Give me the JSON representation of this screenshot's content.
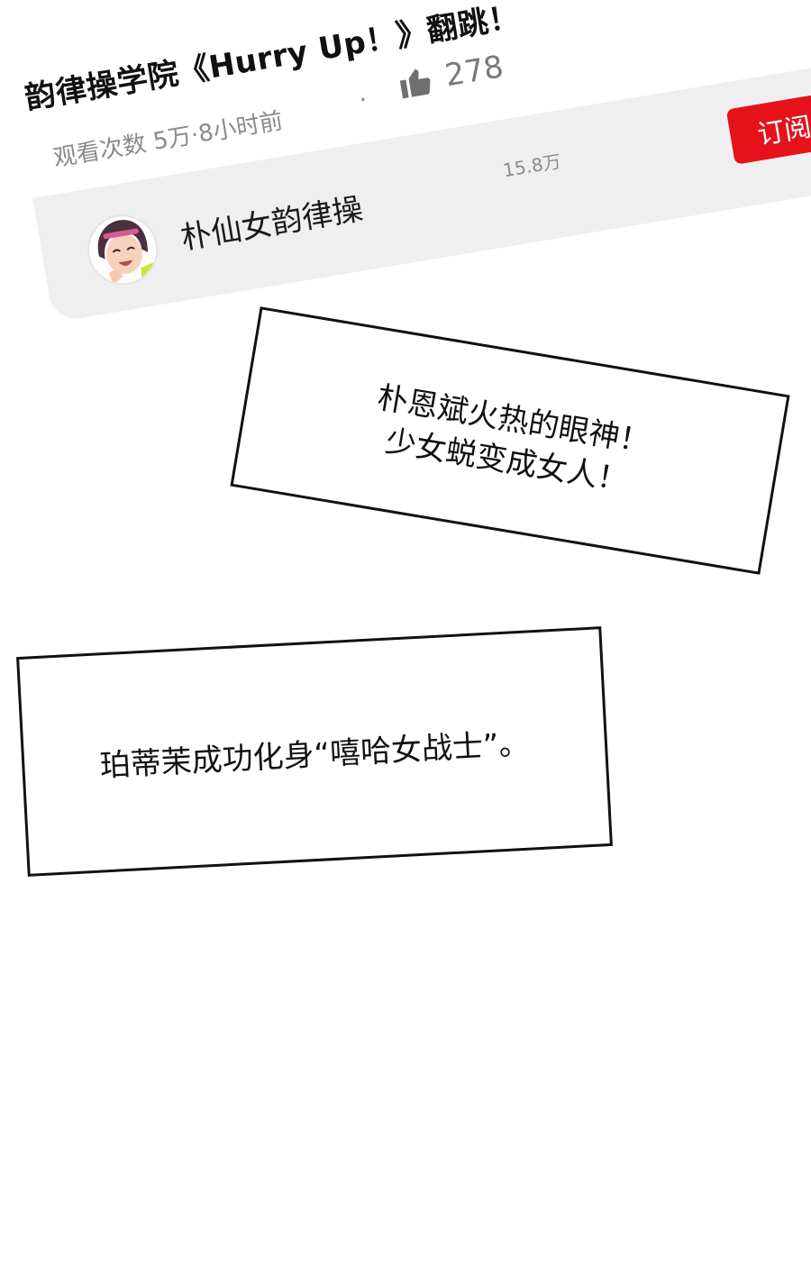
{
  "video": {
    "title": "韵律操学院《Hurry Up！》翻跳！",
    "views_time": "观看次数 5万·8小时前",
    "separator": "·",
    "likes": "278",
    "like_icon": "thumbs-up-icon"
  },
  "channel": {
    "name": "朴仙女韵律操",
    "subscribers": "15.8万",
    "subscribe_label": "订阅",
    "subscribe_color": "#e5121b"
  },
  "captions": [
    {
      "lines": [
        "朴恩斌火热的眼神！",
        "少女蜕变成女人！"
      ]
    },
    {
      "lines": [
        "珀蒂茉成功化身“嘻哈女战士”。"
      ]
    }
  ]
}
